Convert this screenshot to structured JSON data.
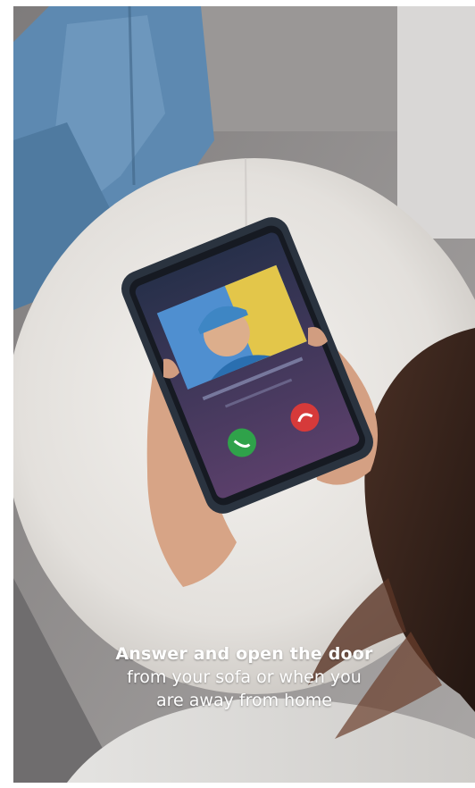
{
  "caption": {
    "line1": "Answer and open the door",
    "line2": "from your sofa or when you",
    "line3": "are away from home"
  },
  "colors": {
    "sofa": "#8f8c8b",
    "cushion": "#e9e7e3",
    "jeans": "#5b86ad",
    "skin": "#d8a889",
    "hair": "#3b2720",
    "phone_case": "#2b3440",
    "accept_button": "#2fa24a",
    "decline_button": "#d63a3a"
  },
  "icons": {
    "accept": "phone-accept-icon",
    "decline": "phone-decline-icon"
  }
}
